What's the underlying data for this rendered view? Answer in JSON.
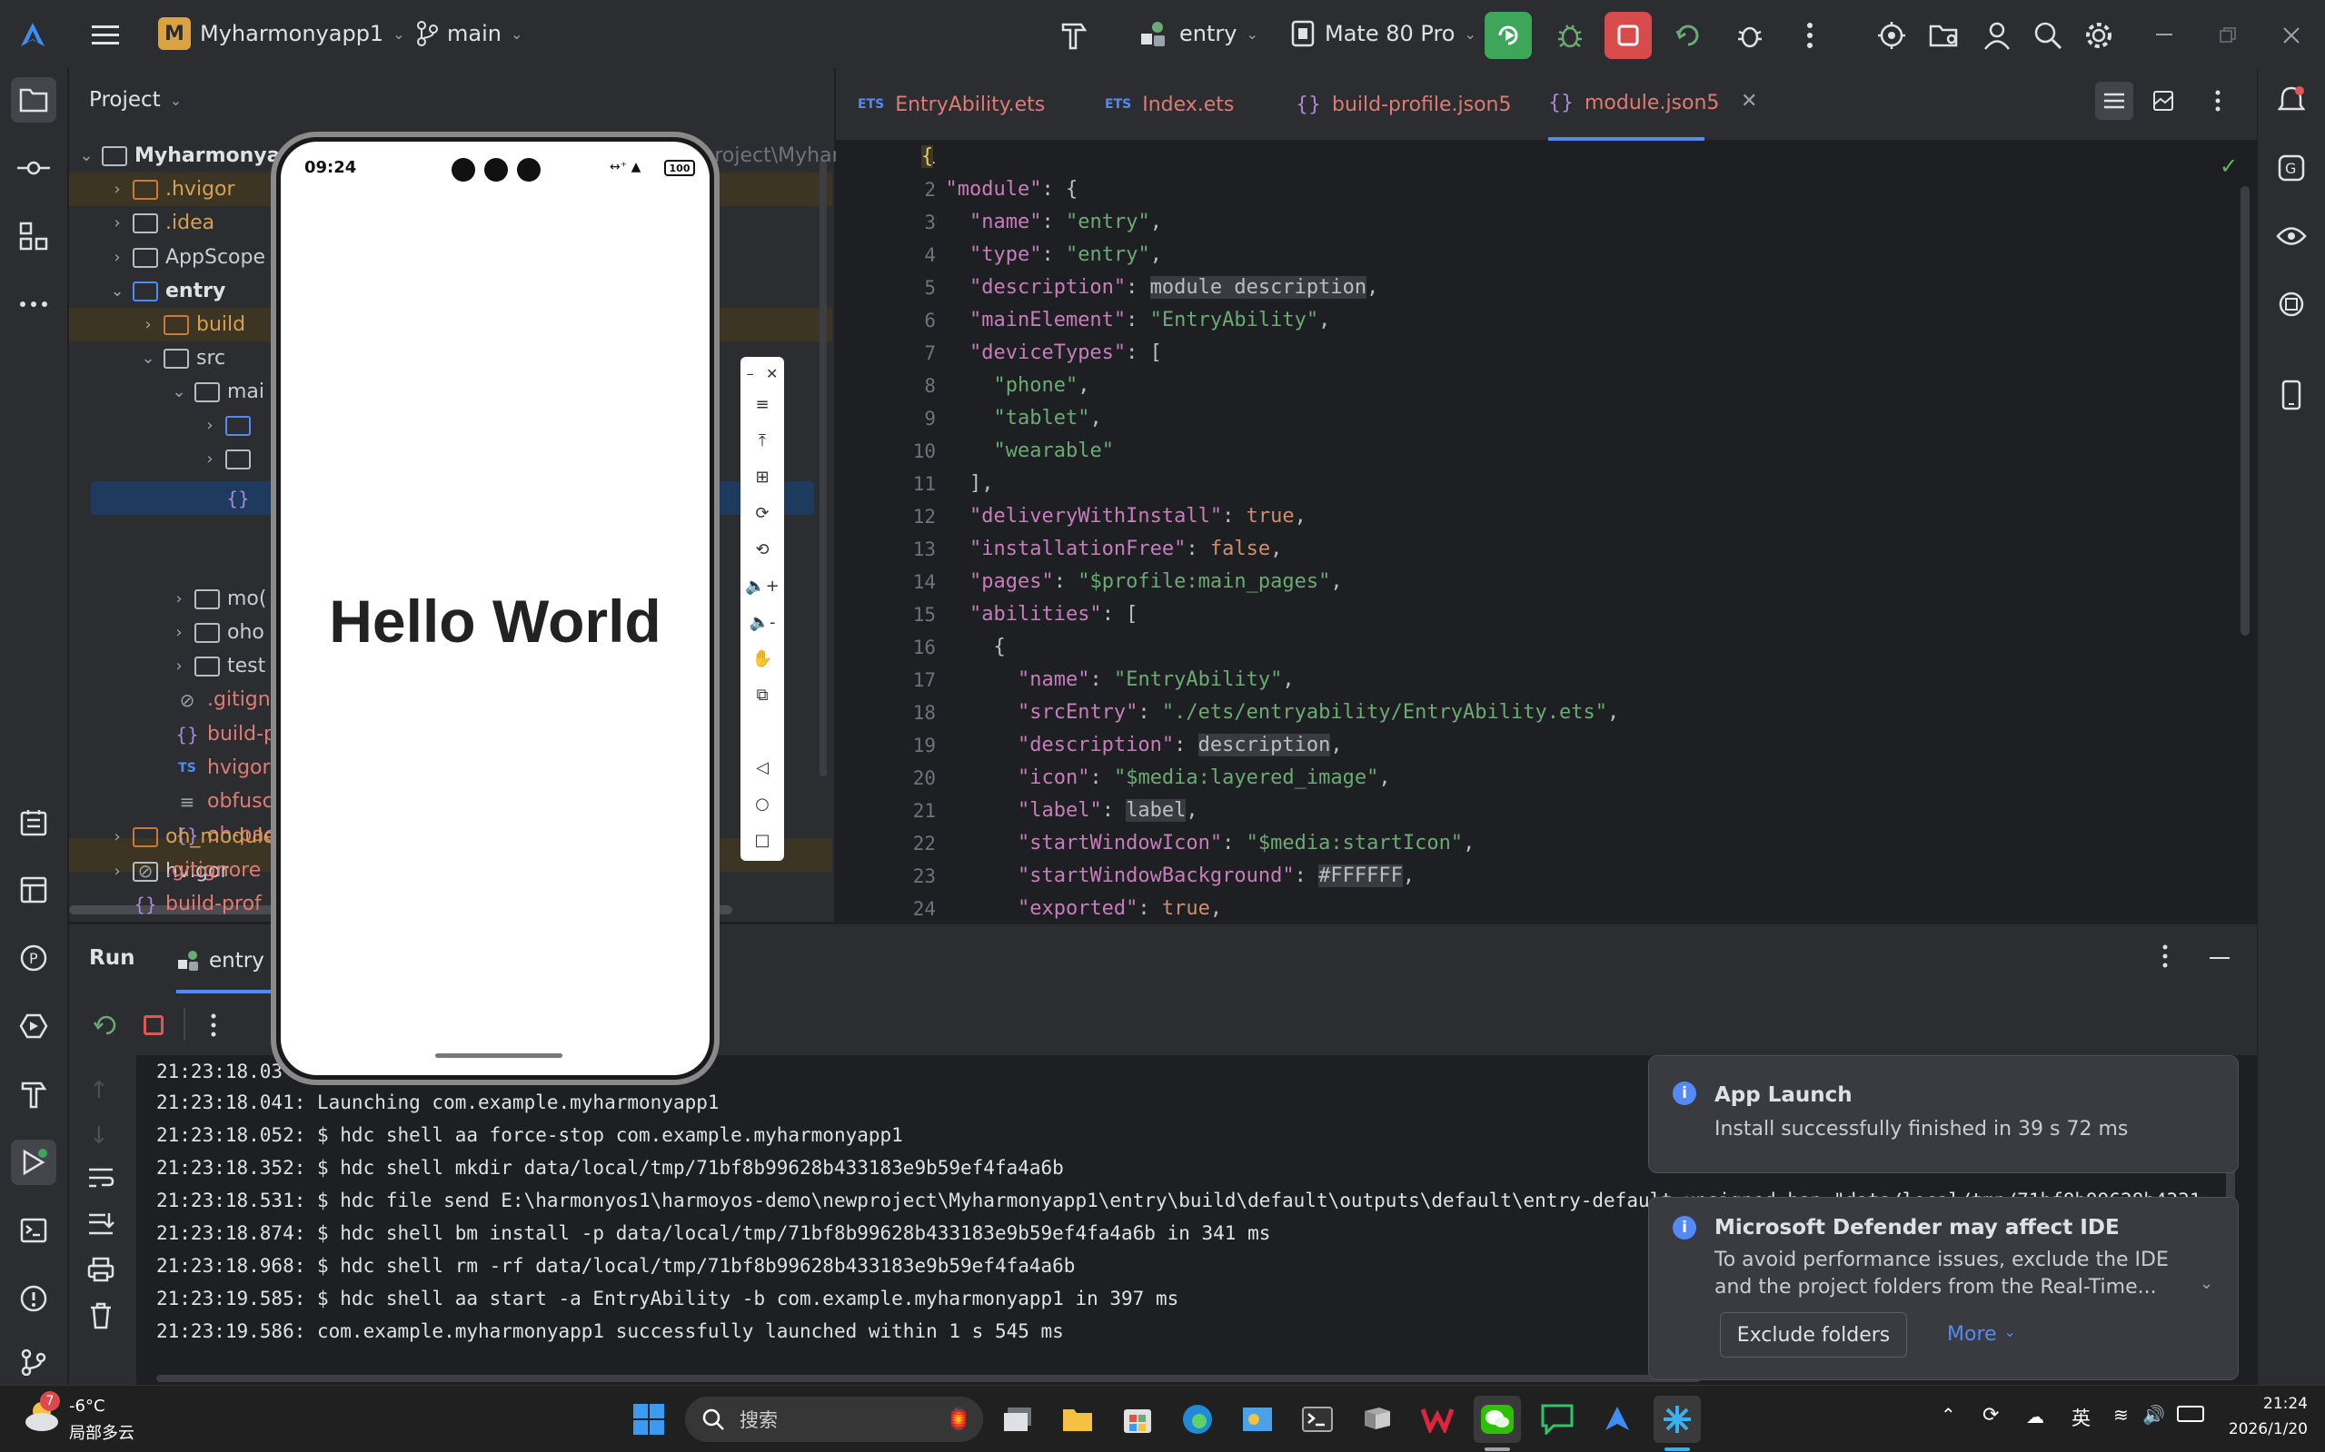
{
  "titlebar": {
    "project_initial": "M",
    "project_name": "Myharmonyapp1",
    "branch": "main",
    "run_config": "entry",
    "device": "Mate 80 Pro"
  },
  "project_panel": {
    "title": "Project",
    "tree": [
      {
        "label": "Myharmonyapp1",
        "suffix": "E:\\harmonyos1\\harmoyos-demo\\newproject\\Myharmon",
        "color": "#dfe1e5",
        "bold": true
      },
      {
        "label": ".hvigor",
        "color": "#d5a150"
      },
      {
        "label": ".idea",
        "color": "#d5a150"
      },
      {
        "label": "AppScope",
        "color": "#c9ccd1"
      },
      {
        "label": "entry",
        "color": "#dfe1e5",
        "bold": true
      },
      {
        "label": "build",
        "color": "#d5a150"
      },
      {
        "label": "src",
        "color": "#c9ccd1"
      },
      {
        "label": "mai",
        "color": "#c9ccd1"
      },
      {
        "label": "",
        "color": "#c9ccd1"
      },
      {
        "label": "",
        "color": "#c9ccd1"
      },
      {
        "label": "",
        "color": "#c9ccd1"
      },
      {
        "label": "mo(",
        "color": "#c9ccd1"
      },
      {
        "label": "oho",
        "color": "#c9ccd1"
      },
      {
        "label": "test",
        "color": "#c9ccd1"
      },
      {
        "label": ".gitigno",
        "color": "#e07a72"
      },
      {
        "label": "build-p",
        "color": "#e07a72"
      },
      {
        "label": "hvigorf",
        "color": "#e07a72"
      },
      {
        "label": "obfusc",
        "color": "#e07a72"
      },
      {
        "label": "oh-pac",
        "color": "#e07a72"
      },
      {
        "label": "hvigor",
        "color": "#c9ccd1"
      },
      {
        "label": "oh_module",
        "color": "#d5a150"
      },
      {
        "label": ".gitignore",
        "color": "#e07a72"
      },
      {
        "label": "build-prof",
        "color": "#e07a72"
      }
    ]
  },
  "tabs": [
    {
      "label": "EntryAbility.ets"
    },
    {
      "label": "Index.ets"
    },
    {
      "label": "build-profile.json5"
    },
    {
      "label": "module.json5"
    }
  ],
  "code_lines": [
    "1",
    "2",
    "3",
    "4",
    "5",
    "6",
    "7",
    "8",
    "9",
    "10",
    "11",
    "12",
    "13",
    "14",
    "15",
    "16",
    "17",
    "18",
    "19",
    "20",
    "21",
    "22",
    "23",
    "24"
  ],
  "run": {
    "title": "Run",
    "tab": "entry",
    "logs": [
      "21:23:18.03",
      "21:23:18.041: Launching com.example.myharmonyapp1",
      "21:23:18.052: $ hdc shell aa force-stop com.example.myharmonyapp1",
      "21:23:18.352: $ hdc shell mkdir data/local/tmp/71bf8b99628b433183e9b59ef4fa4a6b",
      "21:23:18.531: $ hdc file send E:\\harmonyos1\\harmoyos-demo\\newproject\\Myharmonyapp1\\entry\\build\\default\\outputs\\default\\entry-default-unsigned.hap \"data/local/tmp/71bf8b99628b4331",
      "21:23:18.874: $ hdc shell bm install -p data/local/tmp/71bf8b99628b433183e9b59ef4fa4a6b in 341 ms",
      "21:23:18.968: $ hdc shell rm -rf data/local/tmp/71bf8b99628b433183e9b59ef4fa4a6b",
      "21:23:19.585: $ hdc shell aa start -a EntryAbility -b com.example.myharmonyapp1 in 397 ms",
      "21:23:19.586: com.example.myharmonyapp1 successfully launched within 1 s 545 ms"
    ]
  },
  "notifications": {
    "launch": {
      "title": "App Launch",
      "body": "Install successfully finished in 39 s 72 ms"
    },
    "defender": {
      "title": "Microsoft Defender may affect IDE",
      "body1": "To avoid performance issues, exclude the IDE",
      "body2": "and the project folders from the Real-Time...",
      "button": "Exclude folders",
      "more": "More"
    }
  },
  "phone": {
    "time": "09:24",
    "battery": "100",
    "text": "Hello World"
  },
  "taskbar": {
    "weather_badge": "7",
    "temperature": "-6°C",
    "weather": "局部多云",
    "search": "搜索",
    "ime": "英",
    "time": "21:24",
    "date": "2026/1/20"
  }
}
